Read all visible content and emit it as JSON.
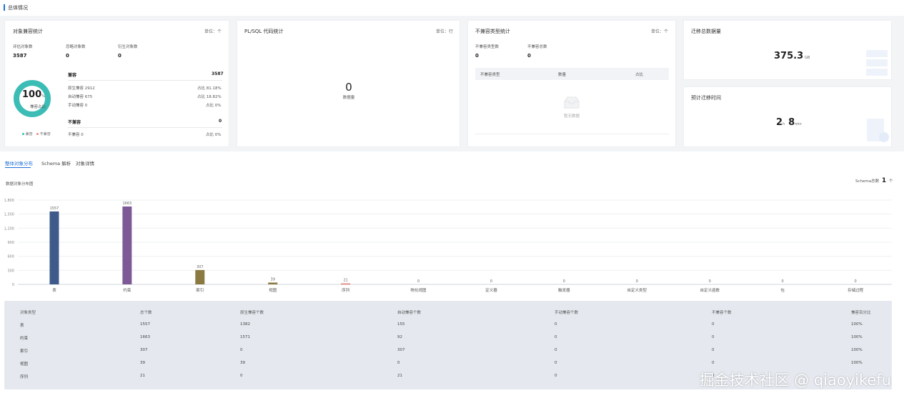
{
  "header": {
    "title": "总体情况"
  },
  "compat_card": {
    "title": "对象兼容统计",
    "unit": "单位：个",
    "stats": [
      {
        "label": "评估对象数",
        "value": "3587"
      },
      {
        "label": "忽略对象数",
        "value": "0"
      },
      {
        "label": "衍生对象数",
        "value": "0"
      }
    ],
    "ring": {
      "percent": "100",
      "percent_unit": "%",
      "caption": "兼容占比",
      "fill_fraction": 1.0,
      "color": "#3bbdb5"
    },
    "legend": [
      {
        "label": "兼容",
        "color": "#3bbdb5"
      },
      {
        "label": "不兼容",
        "color": "#f28b82"
      }
    ],
    "compat_label": "兼容",
    "compat_total": "3587",
    "compat_rows": [
      {
        "label": "原生兼容 2912",
        "ratio": "占比 81.18%"
      },
      {
        "label": "自动兼容 675",
        "ratio": "占比 18.82%"
      },
      {
        "label": "手动兼容 0",
        "ratio": "占比 0%"
      }
    ],
    "incompat_label": "不兼容",
    "incompat_total": "0",
    "incompat_rows": [
      {
        "label": "不兼容 0",
        "ratio": "占比 0%"
      }
    ]
  },
  "plsql_card": {
    "title": "PL/SQL 代码统计",
    "unit": "单位：行",
    "value": "0",
    "caption": "数据量"
  },
  "incompat_card": {
    "title": "不兼容类型统计",
    "unit": "单位：个",
    "stats": [
      {
        "label": "不兼容类型数",
        "value": "0"
      },
      {
        "label": "不兼容总数",
        "value": "0"
      }
    ],
    "columns": [
      "不兼容类型",
      "数量",
      "占比"
    ],
    "empty_text": "暂无数据"
  },
  "migrate_card": {
    "title": "迁移总数据量",
    "value": "375.3",
    "unit": "GB"
  },
  "time_card": {
    "title": "预计迁移时间",
    "hours": "2",
    "hours_unit": "h",
    "minutes": "8",
    "minutes_unit": "min"
  },
  "tabs": [
    {
      "label": "整体对象分布",
      "active": true
    },
    {
      "label": "Schema 解析",
      "active": false
    },
    {
      "label": "对象详情",
      "active": false
    }
  ],
  "chart_header": {
    "title": "数据对象分布图",
    "schema_label": "Schema总数",
    "schema_value": "1",
    "schema_unit": "个"
  },
  "chart_data": {
    "type": "bar",
    "categories": [
      "表",
      "约束",
      "索引",
      "视图",
      "序列",
      "物化视图",
      "定义器",
      "触发器",
      "自定义类型",
      "自定义函数",
      "包",
      "存储过程"
    ],
    "values": [
      1557,
      1663,
      307,
      39,
      21,
      0,
      0,
      0,
      0,
      0,
      0,
      0
    ],
    "colors": [
      "#3d5a8a",
      "#7d5a96",
      "#8a7a42",
      "#8a7a42",
      "#e07b6e",
      "#888888",
      "#888888",
      "#888888",
      "#888888",
      "#888888",
      "#888888",
      "#888888"
    ],
    "yticks": [
      "0",
      "300",
      "600",
      "900",
      "1,200",
      "1,500",
      "1,800"
    ],
    "ylim": [
      0,
      1800
    ],
    "grid": true
  },
  "table": {
    "columns": [
      "对象类型",
      "总个数",
      "原生兼容个数",
      "自动兼容个数",
      "手动兼容个数",
      "不兼容个数",
      "兼容百分比"
    ],
    "rows": [
      [
        "表",
        "1557",
        "1382",
        "155",
        "0",
        "0",
        "100%"
      ],
      [
        "约束",
        "1663",
        "1571",
        "92",
        "0",
        "0",
        "100%"
      ],
      [
        "索引",
        "307",
        "0",
        "307",
        "0",
        "0",
        "100%"
      ],
      [
        "视图",
        "39",
        "39",
        "0",
        "0",
        "0",
        "100%"
      ],
      [
        "序列",
        "21",
        "0",
        "21",
        "0",
        "0",
        ""
      ]
    ]
  },
  "watermark": "掘金技术社区 @ qiaoyikefu"
}
